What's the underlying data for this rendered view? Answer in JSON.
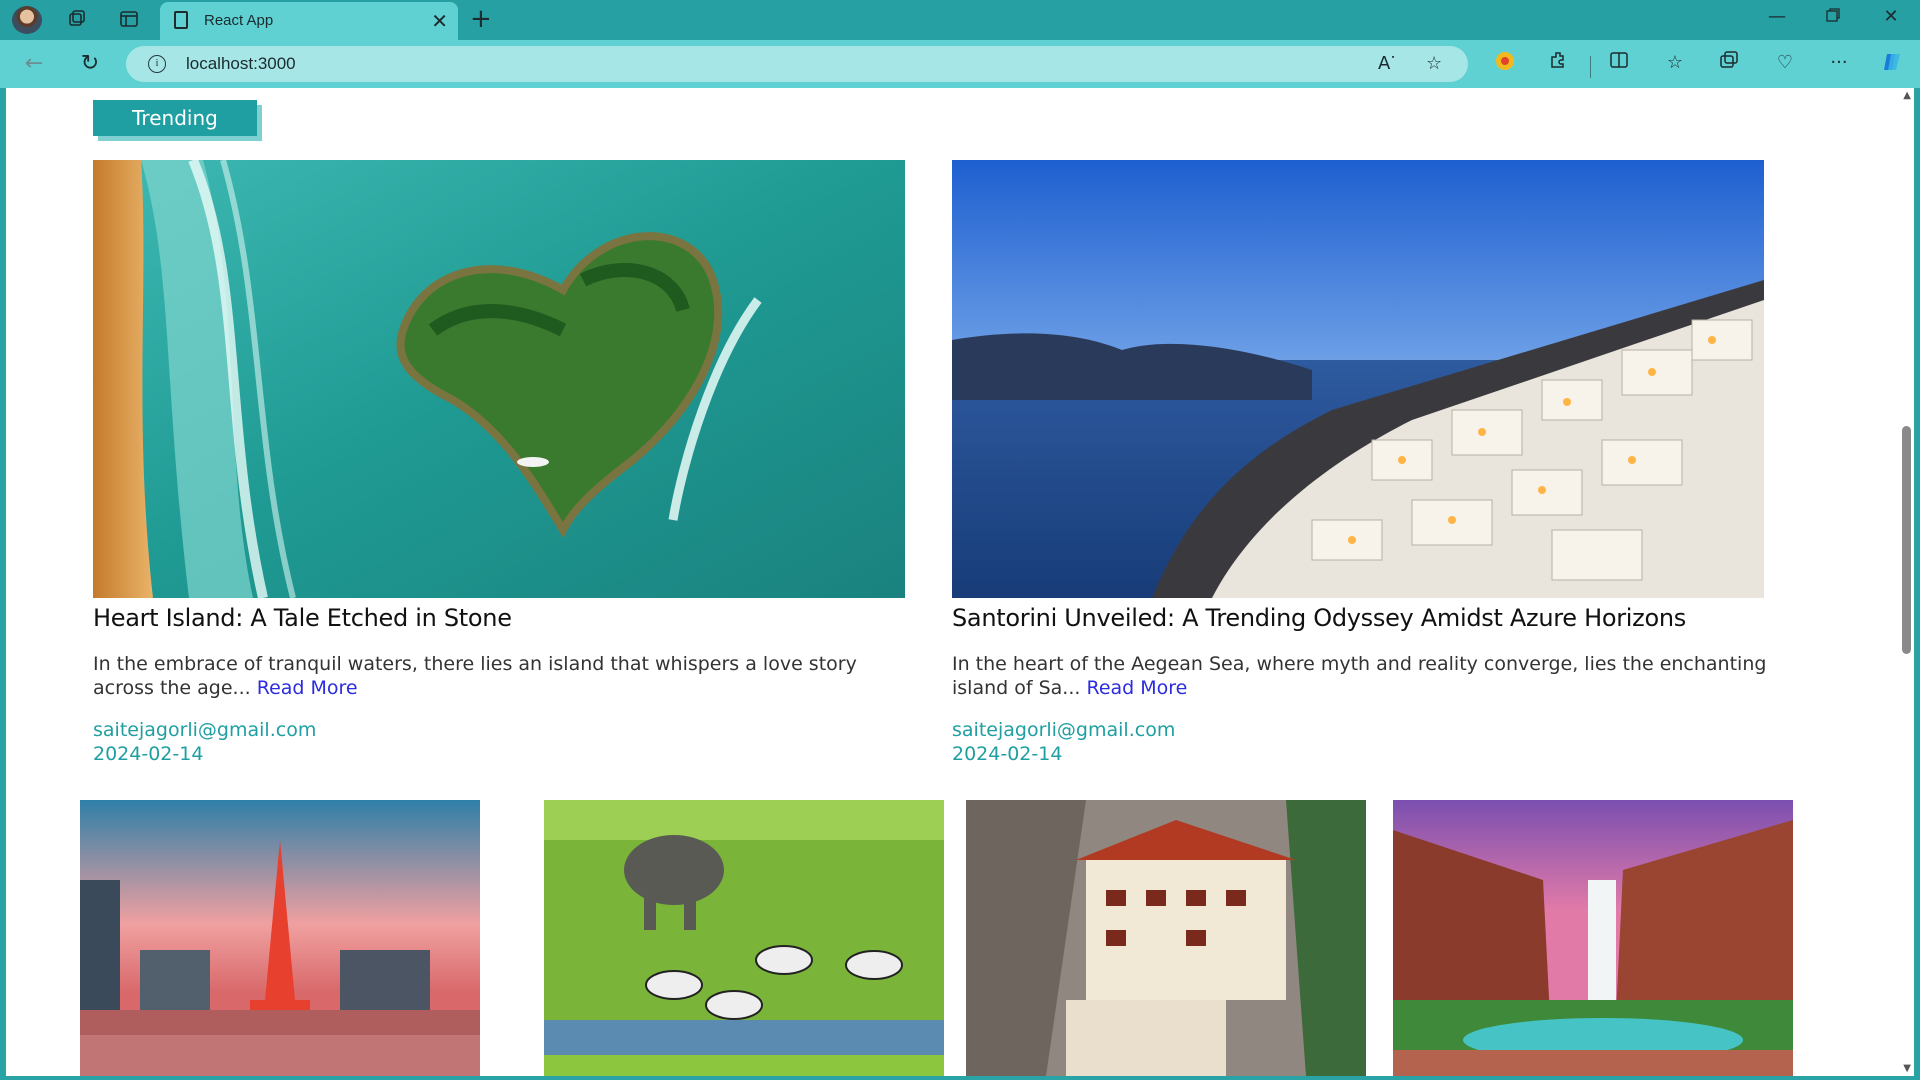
{
  "browser": {
    "tab_title": "React App",
    "url": "localhost:3000"
  },
  "page": {
    "section_label": "Trending",
    "read_more_label": "Read More",
    "featured": [
      {
        "title": "Heart Island: A Tale Etched in Stone",
        "excerpt": "In the embrace of tranquil waters, there lies an island that whispers a love story across the age...",
        "author": "saitejagorli@gmail.com",
        "date": "2024-02-14",
        "image": "heart-island-aerial"
      },
      {
        "title": "Santorini Unveiled: A Trending Odyssey Amidst Azure Horizons",
        "excerpt": "In the heart of the Aegean Sea, where myth and reality converge, lies the enchanting island of Sa...",
        "author": "saitejagorli@gmail.com",
        "date": "2024-02-14",
        "image": "santorini-sunset"
      }
    ],
    "thumbnails": [
      {
        "image": "tokyo-tower-street"
      },
      {
        "image": "elephant-zebras-savanna"
      },
      {
        "image": "tigers-nest-monastery"
      },
      {
        "image": "canyon-waterfall"
      }
    ]
  },
  "colors": {
    "accent": "#1f9fa2",
    "link": "#2b2be0",
    "browser_frame": "#26a0a2",
    "address_bar": "#5fd1d2"
  }
}
